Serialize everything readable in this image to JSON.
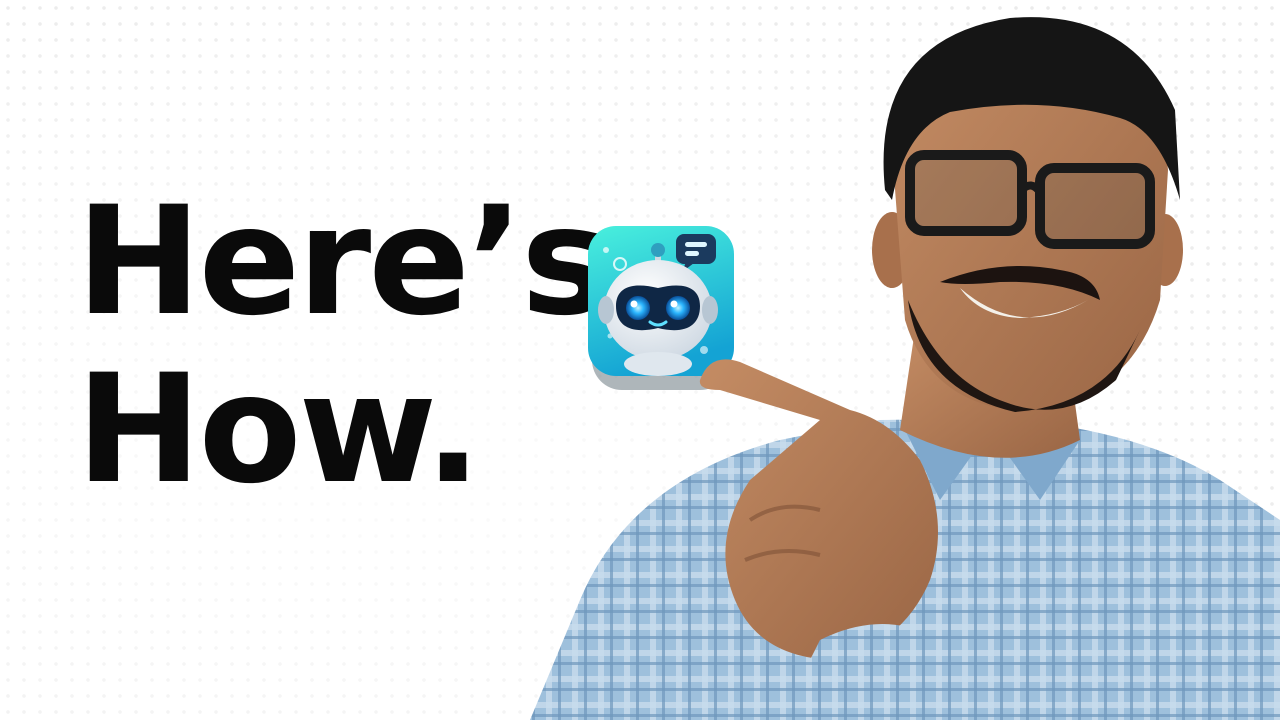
{
  "headline": {
    "line1": "Here’s",
    "line2": "How."
  },
  "app_icon": {
    "icon_name": "robot-chat-app-icon",
    "colors": {
      "gradient_top": "#3ee7d9",
      "gradient_bottom": "#1aa9d8",
      "eyes": "#27a6ff"
    }
  },
  "person": {
    "description_icon": "man-pointing-photo",
    "colors": {
      "shirt": "#8fb6d6",
      "skin": "#b07a55",
      "hair": "#141414"
    }
  }
}
